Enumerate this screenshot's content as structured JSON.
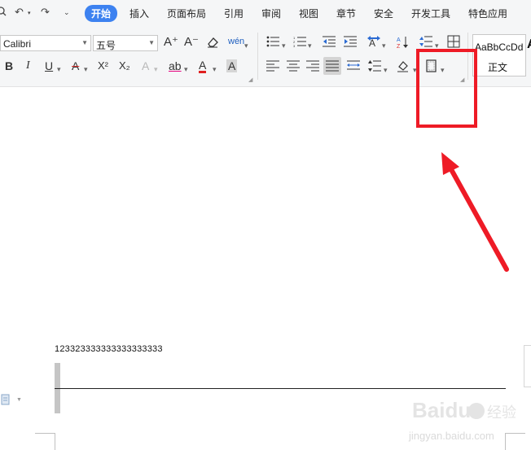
{
  "quick_access": {
    "search_icon": "search-icon",
    "undo_icon": "undo-icon",
    "redo_icon": "redo-icon",
    "more_icon": "chevron-down-icon"
  },
  "menu_tabs": [
    {
      "label": "开始",
      "active": true
    },
    {
      "label": "插入"
    },
    {
      "label": "页面布局"
    },
    {
      "label": "引用"
    },
    {
      "label": "审阅"
    },
    {
      "label": "视图"
    },
    {
      "label": "章节"
    },
    {
      "label": "安全"
    },
    {
      "label": "开发工具"
    },
    {
      "label": "特色应用"
    }
  ],
  "font": {
    "family": "Calibri",
    "size": "五号"
  },
  "font_buttons": {
    "grow": "A⁺",
    "shrink": "A⁻",
    "pinyin": "wén"
  },
  "format_buttons": {
    "bold": "B",
    "italic": "I",
    "underline": "U",
    "strikethrough": "A",
    "superscript": "X²",
    "subscript": "X₂",
    "text_effect": "A",
    "highlight": "ab",
    "font_color": "A",
    "char_shading": "A"
  },
  "style_gallery": {
    "preview": "AaBbCcDd",
    "name": "正文",
    "next_preview": "A"
  },
  "document": {
    "text": "123323333333333333333"
  },
  "colors": {
    "accent": "#3d82f0",
    "annotation": "#ee1b26",
    "ribbon_bg": "#f5f6f7"
  },
  "watermark": {
    "brand": "Baidu",
    "jingyan": "经验",
    "url": "jingyan.baidu.com"
  }
}
